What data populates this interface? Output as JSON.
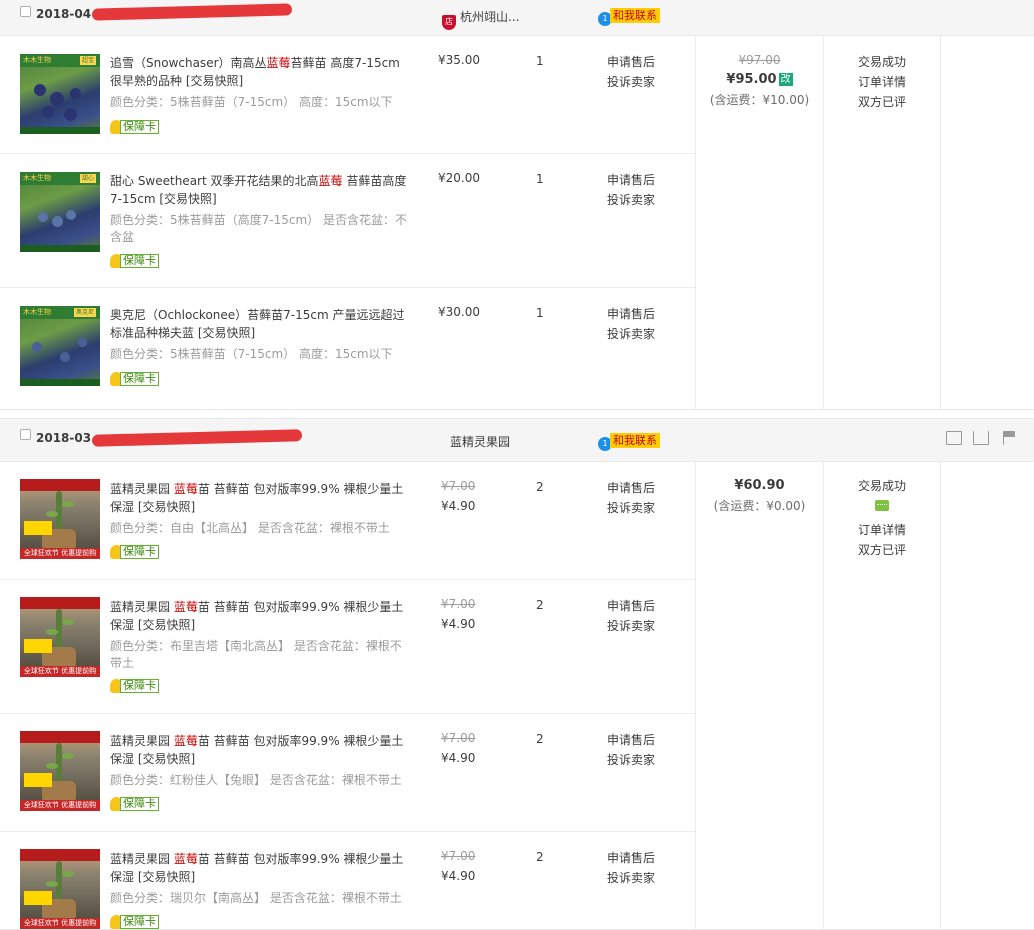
{
  "orders": [
    {
      "date": "2018-04",
      "shop": "杭州翊山...",
      "contact": "和我联系",
      "total_orig": "¥97.00",
      "total": "¥95.00",
      "total_tag": "改",
      "freight": "(含运费：¥10.00)",
      "status": "交易成功",
      "detail": "订单详情",
      "review": "双方已评",
      "items": [
        {
          "title_a": "追雪（Snowchaser）南高丛",
          "title_hl": "蓝莓",
          "title_b": "苔藓苗 高度7-15cm 很早熟的品种 [交易快照]",
          "spec": "颜色分类：5株苔藓苗（7-15cm）  高度：15cm以下",
          "badge": "保障卡",
          "price": "¥35.00",
          "qty": "1",
          "op1": "申请售后",
          "op2": "投诉卖家",
          "img_brand": "木木生物",
          "img_tag": "超宝"
        },
        {
          "title_a": "甜心 Sweetheart 双季开花结果的北高",
          "title_hl": "蓝莓",
          "title_b": " 苔藓苗高度7-15cm [交易快照]",
          "spec": "颜色分类：5株苔藓苗（高度7-15cm）  是否含花盆：不含盆",
          "badge": "保障卡",
          "price": "¥20.00",
          "qty": "1",
          "op1": "申请售后",
          "op2": "投诉卖家",
          "img_brand": "木木生物",
          "img_tag": "甜心"
        },
        {
          "title_a": "奥克尼（Ochlockonee）苔藓苗7-15cm 产量远远超过标准品种梯夫蓝 [交易快照]",
          "title_hl": "",
          "title_b": "",
          "spec": "颜色分类：5株苔藓苗（7-15cm）  高度：15cm以下",
          "badge": "保障卡",
          "price": "¥30.00",
          "qty": "1",
          "op1": "申请售后",
          "op2": "投诉卖家",
          "img_brand": "木木生物",
          "img_tag": "奥克尼"
        }
      ]
    },
    {
      "date": "2018-03",
      "shop": "蓝精灵果园",
      "contact": "和我联系",
      "total": "¥60.90",
      "freight": "(含运费：¥0.00)",
      "status": "交易成功",
      "detail": "订单详情",
      "review": "双方已评",
      "items": [
        {
          "title_a": "蓝精灵果园 ",
          "title_hl": "蓝莓",
          "title_b": "苗 苔藓苗 包对版率99.9% 裸根少量土保湿 [交易快照]",
          "spec": "颜色分类：自由【北高丛】  是否含花盆：裸根不带土",
          "badge": "保障卡",
          "orig": "¥7.00",
          "price": "¥4.90",
          "qty": "2",
          "op1": "申请售后",
          "op2": "投诉卖家",
          "img_promo": "全球狂欢节 优惠提前购"
        },
        {
          "title_a": "蓝精灵果园 ",
          "title_hl": "蓝莓",
          "title_b": "苗 苔藓苗 包对版率99.9% 裸根少量土保湿 [交易快照]",
          "spec": "颜色分类：布里吉塔【南北高丛】  是否含花盆：裸根不带土",
          "badge": "保障卡",
          "orig": "¥7.00",
          "price": "¥4.90",
          "qty": "2",
          "op1": "申请售后",
          "op2": "投诉卖家",
          "img_promo": "全球狂欢节 优惠提前购"
        },
        {
          "title_a": "蓝精灵果园 ",
          "title_hl": "蓝莓",
          "title_b": "苗 苔藓苗 包对版率99.9% 裸根少量土保湿 [交易快照]",
          "spec": "颜色分类：红粉佳人【兔眼】  是否含花盆：裸根不带土",
          "badge": "保障卡",
          "orig": "¥7.00",
          "price": "¥4.90",
          "qty": "2",
          "op1": "申请售后",
          "op2": "投诉卖家",
          "img_promo": "全球狂欢节 优惠提前购"
        },
        {
          "title_a": "蓝精灵果园 ",
          "title_hl": "蓝莓",
          "title_b": "苗 苔藓苗 包对版率99.9% 裸根少量土保湿 [交易快照]",
          "spec": "颜色分类：瑞贝尔【南高丛】  是否含花盆：裸根不带土",
          "badge": "保障卡",
          "orig": "¥7.00",
          "price": "¥4.90",
          "qty": "2",
          "op1": "申请售后",
          "op2": "投诉卖家",
          "img_promo": "全球狂欢节 优惠提前购"
        }
      ]
    }
  ],
  "colors": {
    "highlight": "#cc0000",
    "contact_bg": "#ffcd03",
    "badge_green": "#68b22b",
    "modify_tag": "#19a97b",
    "redaction": "#e5383b"
  }
}
